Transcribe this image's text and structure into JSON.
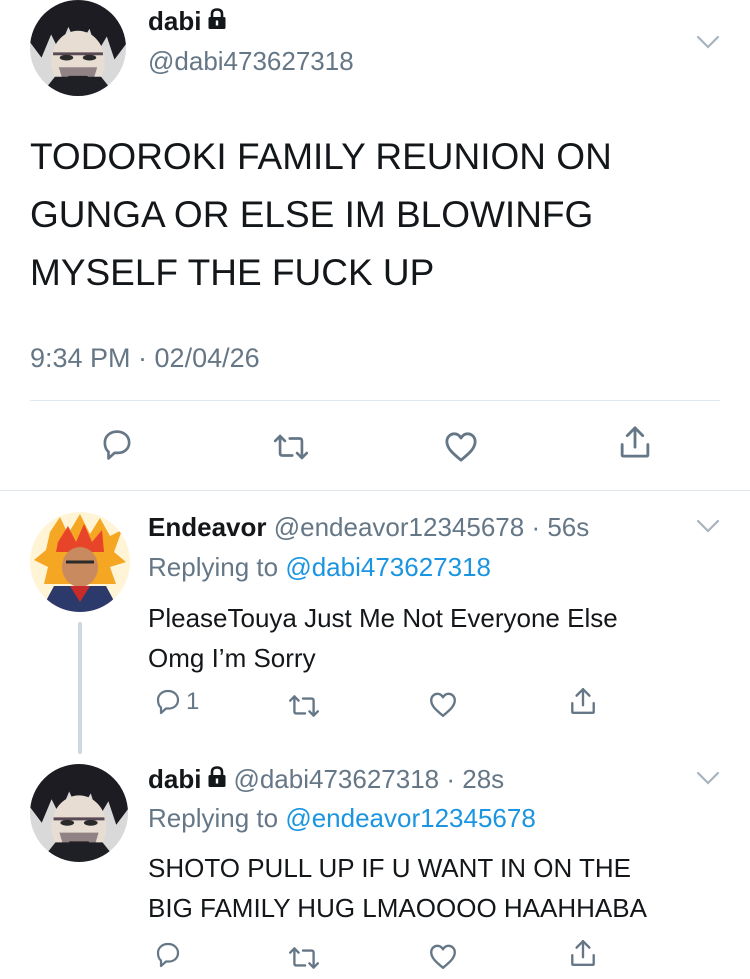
{
  "main_tweet": {
    "display_name": "dabi",
    "handle": "@dabi473627318",
    "text_lines": [
      "TODOROKI FAMILY REUNION ON",
      "GUNGA OR ELSE IM BLOWINFG",
      "MYSELF THE FUCK UP"
    ],
    "timestamp": "9:34 PM · 02/04/26"
  },
  "reply1": {
    "display_name": "Endeavor",
    "handle_time": "@endeavor12345678 · 56s",
    "replying_prefix": "Replying to",
    "replying_handle": "@dabi473627318",
    "text_lines": [
      "PleaseTouya Just Me Not Everyone Else",
      "Omg I’m Sorry"
    ],
    "reply_count": "1"
  },
  "reply2": {
    "display_name": "dabi",
    "handle_time": "@dabi473627318 · 28s",
    "replying_prefix": "Replying to",
    "replying_handle": "@endeavor12345678",
    "text_lines": [
      "SHOTO PULL UP IF U WANT IN ON THE",
      "BIG FAMILY HUG LMAOOOO HAAHHABA"
    ]
  },
  "icons": {
    "lock": "lock-icon",
    "chevron": "chevron-down-icon",
    "reply": "reply-icon",
    "retweet": "retweet-icon",
    "like": "like-icon",
    "share": "share-icon"
  },
  "colors": {
    "text": "#14171a",
    "secondary": "#657786",
    "link": "#1b95e0",
    "divider": "#e1e8ed"
  }
}
